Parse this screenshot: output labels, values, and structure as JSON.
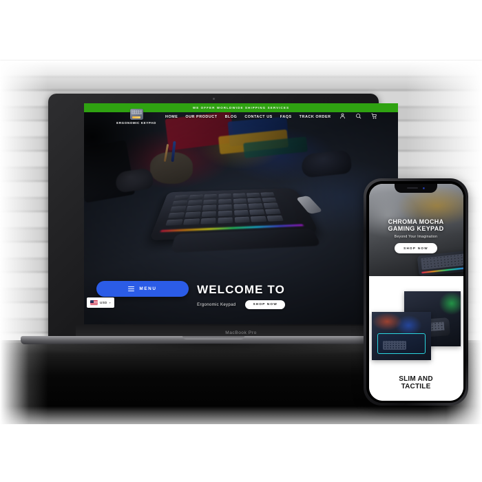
{
  "scene": {
    "device_label": "MacBook Pro"
  },
  "desktop_site": {
    "announcement": "WE OFFER WORLDWIDE SHIPPING SERVICES",
    "logo": {
      "text": "ERGONOMIC KEYPAD",
      "icon": "keypad-icon"
    },
    "nav": [
      {
        "label": "HOME"
      },
      {
        "label": "OUR PRODUCT"
      },
      {
        "label": "BLOG"
      },
      {
        "label": "CONTACT US"
      },
      {
        "label": "FAQS"
      },
      {
        "label": "TRACK ORDER"
      }
    ],
    "header_icons": [
      {
        "name": "account-icon"
      },
      {
        "name": "search-icon"
      },
      {
        "name": "cart-icon"
      }
    ],
    "hero": {
      "title": "WELCOME TO",
      "subtitle": "Ergonomic Keypad",
      "cta": "SHOP NOW"
    },
    "menu_widget": {
      "label": "MENU",
      "icon": "hamburger-icon"
    },
    "currency": {
      "code": "USD",
      "flag": "us-flag-icon",
      "chevron": "▾"
    },
    "colors": {
      "announcement_bg": "#2fa211",
      "menu_button_bg": "#2b5ce6",
      "cta_bg": "#ffffff"
    }
  },
  "mobile_site": {
    "hero": {
      "title_line1": "CHROMA MOCHA",
      "title_line2": "GAMING KEYPAD",
      "subtitle": "Beyond Your Imagination",
      "cta": "SHOP NOW"
    },
    "section": {
      "caption_line1": "SLIM AND",
      "caption_line2": "TACTILE"
    }
  }
}
